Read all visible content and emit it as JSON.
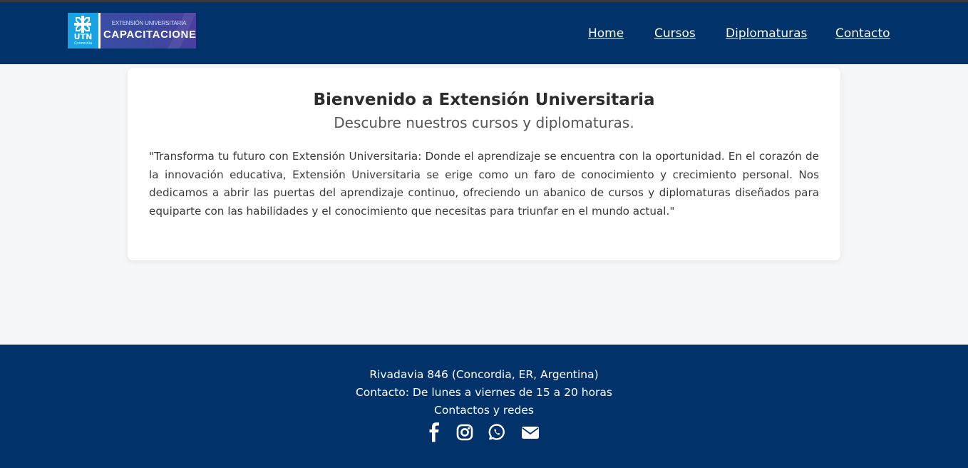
{
  "header": {
    "logo": {
      "badge_text": "UTN",
      "badge_sub": "Concordia",
      "line1": "EXTENSIÓN UNIVERSITARIA",
      "line2": "CAPACITACIONES"
    },
    "nav": [
      {
        "label": "Home"
      },
      {
        "label": "Cursos"
      },
      {
        "label": "Diplomaturas"
      },
      {
        "label": "Contacto"
      }
    ]
  },
  "main": {
    "title": "Bienvenido a Extensión Universitaria",
    "subtitle": "Descubre nuestros cursos y diplomaturas.",
    "quote": "\"Transforma tu futuro con Extensión Universitaria: Donde el aprendizaje se encuentra con la oportunidad. En el corazón de la innovación educativa, Extensión Universitaria se erige como un faro de conocimiento y crecimiento personal. Nos dedicamos a abrir las puertas del aprendizaje continuo, ofreciendo un abanico de cursos y diplomaturas diseñados para equiparte con las habilidades y el conocimiento que necesitas para triunfar en el mundo actual.\""
  },
  "footer": {
    "address": "Rivadavia 846 (Concordia, ER, Argentina)",
    "hours": "Contacto: De lunes a viernes de 15 a 20 horas",
    "networks_label": "Contactos y redes",
    "icons": [
      "facebook-icon",
      "instagram-icon",
      "whatsapp-icon",
      "email-icon"
    ]
  },
  "colors": {
    "brand_navy": "#02326a",
    "page_background": "#f6f7f9",
    "logo_cyan": "#17a3e4",
    "logo_indigo": "#3b49a0"
  }
}
